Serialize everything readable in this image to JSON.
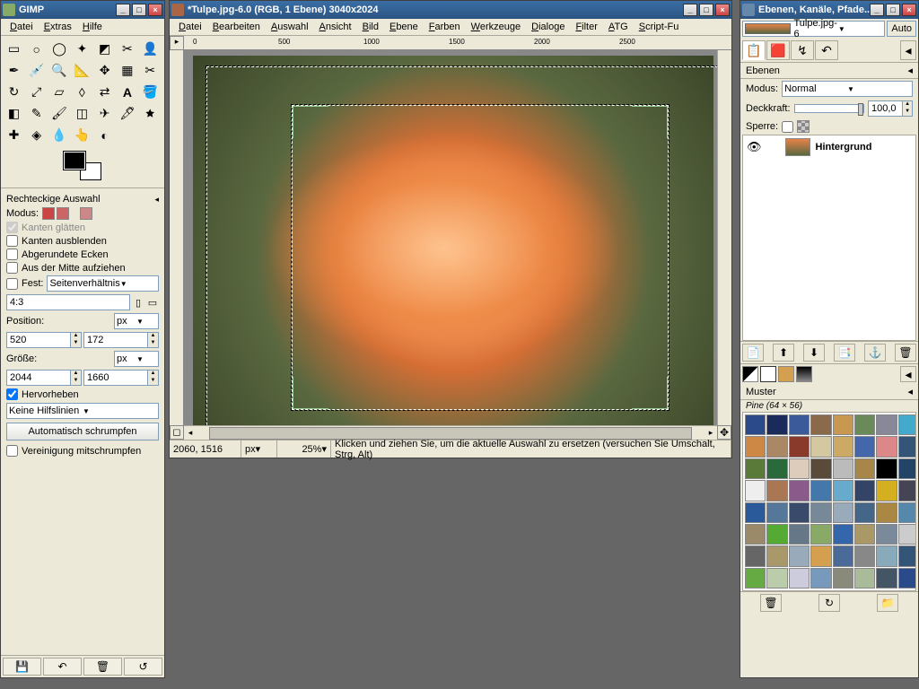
{
  "toolbox": {
    "title": "GIMP",
    "menus": [
      "Datei",
      "Extras",
      "Hilfe"
    ],
    "tool_options_title": "Rechteckige Auswahl",
    "modus_label": "Modus:",
    "antialias": "Kanten glätten",
    "feather": "Kanten ausblenden",
    "rounded": "Abgerundete Ecken",
    "from_center": "Aus der Mitte aufziehen",
    "fixed_label": "Fest:",
    "fixed_type": "Seitenverhältnis",
    "aspect_value": "4:3",
    "position_label": "Position:",
    "unit": "px",
    "pos_x": "520",
    "pos_y": "172",
    "size_label": "Größe:",
    "size_w": "2044",
    "size_h": "1660",
    "highlight": "Hervorheben",
    "guides": "Keine Hilfslinien",
    "autoshrink": "Automatisch schrumpfen",
    "shrink_merged": "Vereinigung mitschrumpfen"
  },
  "image": {
    "title": "*Tulpe.jpg-6.0 (RGB, 1 Ebene) 3040x2024",
    "menus": [
      "Datei",
      "Bearbeiten",
      "Auswahl",
      "Ansicht",
      "Bild",
      "Ebene",
      "Farben",
      "Werkzeuge",
      "Dialoge",
      "Filter",
      "ATG",
      "Script-Fu"
    ],
    "ruler_marks": [
      "0",
      "500",
      "1000",
      "1500",
      "2000",
      "2500"
    ],
    "cursor_pos": "2060, 1516",
    "unit": "px",
    "zoom": "25%",
    "hint": "Klicken und ziehen Sie, um die aktuelle Auswahl zu ersetzen (versuchen Sie Umschalt, Strg, Alt)"
  },
  "layers": {
    "title": "Ebenen, Kanäle, Pfade...",
    "image_dropdown": "Tulpe.jpg-6",
    "auto_button": "Auto",
    "panel_header": "Ebenen",
    "mode_label": "Modus:",
    "mode_value": "Normal",
    "opacity_label": "Deckkraft:",
    "opacity_value": "100,0",
    "lock_label": "Sperre:",
    "layer_name": "Hintergrund",
    "pattern_header": "Muster",
    "pattern_info": "Pine (64 × 56)"
  }
}
